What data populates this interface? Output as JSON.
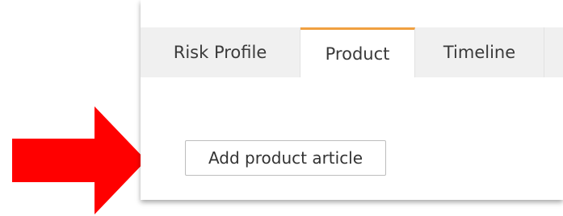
{
  "tabs": [
    {
      "label": "Risk Profile",
      "active": false
    },
    {
      "label": "Product",
      "active": true
    },
    {
      "label": "Timeline",
      "active": false
    }
  ],
  "content": {
    "add_button_label": "Add product article"
  },
  "colors": {
    "active_tab_accent": "#f0a040",
    "callout_arrow": "#ff0000",
    "inactive_tab_bg": "#f0f0f0"
  },
  "icons": {
    "callout": "red-arrow-right-icon"
  }
}
